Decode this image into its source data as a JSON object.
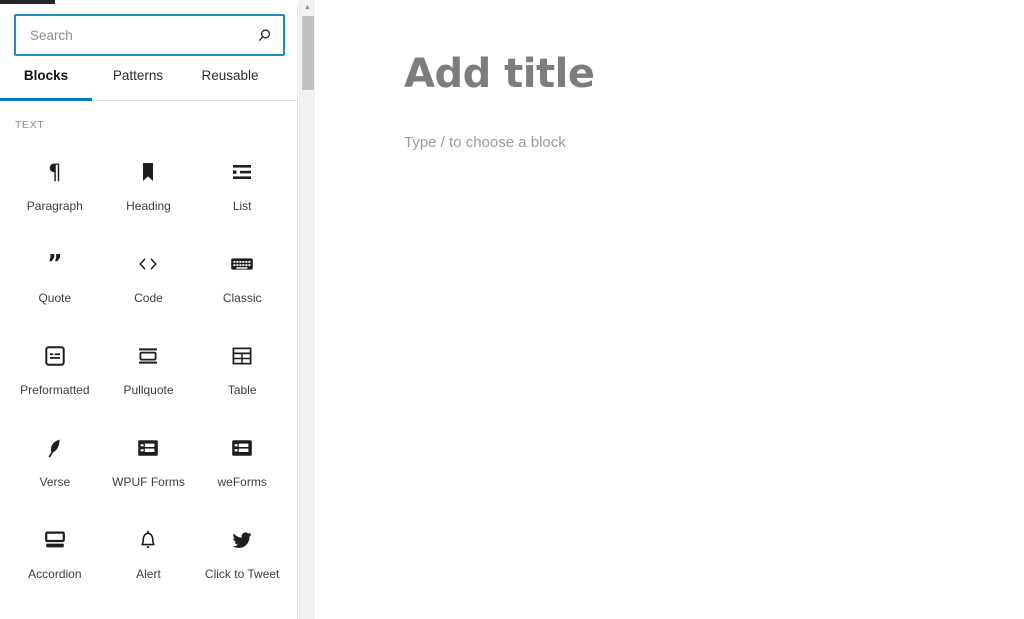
{
  "window": {
    "admin_bar_color": "#23282d",
    "accent_color": "#007cba"
  },
  "inserter": {
    "search": {
      "placeholder": "Search",
      "value": "",
      "icon": "search-icon"
    },
    "tabs": [
      {
        "label": "Blocks",
        "active": true
      },
      {
        "label": "Patterns",
        "active": false
      },
      {
        "label": "Reusable",
        "active": false
      }
    ],
    "categories": [
      {
        "label": "TEXT",
        "blocks": [
          {
            "label": "Paragraph",
            "icon": "paragraph-pilcrow-icon"
          },
          {
            "label": "Heading",
            "icon": "heading-bookmark-icon"
          },
          {
            "label": "List",
            "icon": "bulleted-list-icon"
          },
          {
            "label": "Quote",
            "icon": "quotation-mark-icon"
          },
          {
            "label": "Code",
            "icon": "angle-brackets-icon"
          },
          {
            "label": "Classic",
            "icon": "keyboard-icon"
          },
          {
            "label": "Preformatted",
            "icon": "preformatted-box-icon"
          },
          {
            "label": "Pullquote",
            "icon": "pullquote-icon"
          },
          {
            "label": "Table",
            "icon": "table-grid-icon"
          },
          {
            "label": "Verse",
            "icon": "feather-quill-icon"
          },
          {
            "label": "WPUF Forms",
            "icon": "form-fields-icon"
          },
          {
            "label": "weForms",
            "icon": "form-fields-icon"
          },
          {
            "label": "Accordion",
            "icon": "accordion-panels-icon"
          },
          {
            "label": "Alert",
            "icon": "bell-icon"
          },
          {
            "label": "Click to Tweet",
            "icon": "twitter-bird-icon"
          }
        ]
      }
    ],
    "scrollbar": {
      "up_arrow_glyph": "▲"
    }
  },
  "editor": {
    "title_placeholder": "Add title",
    "block_placeholder": "Type / to choose a block"
  }
}
